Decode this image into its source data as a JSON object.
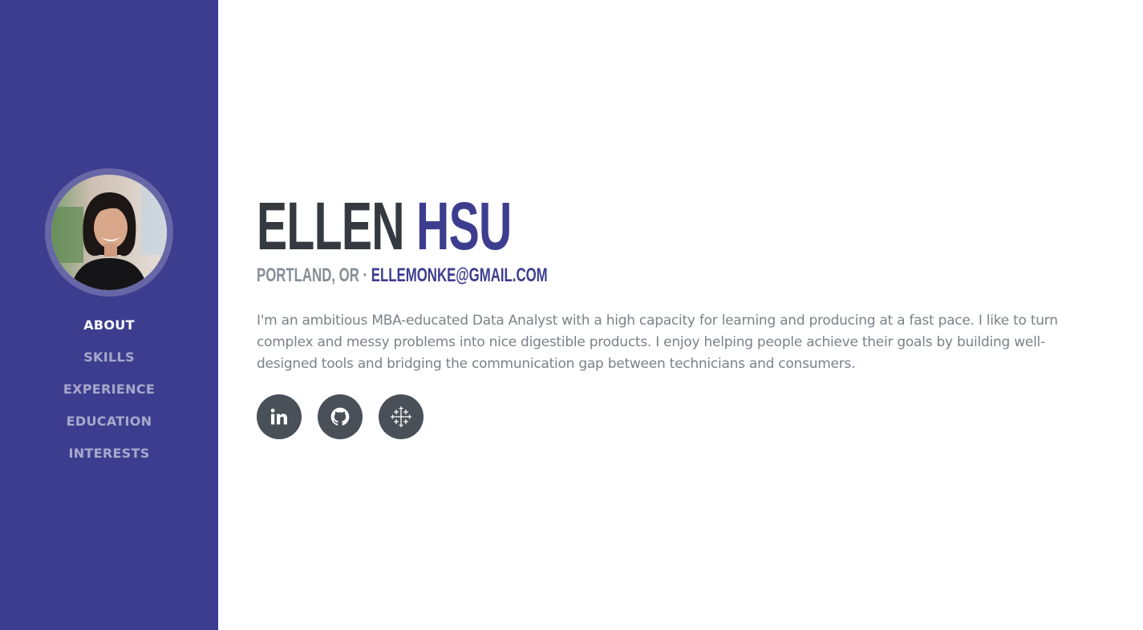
{
  "sidebar": {
    "avatar_alt": "Ellen Hsu profile photo",
    "nav": [
      {
        "label": "ABOUT",
        "active": true
      },
      {
        "label": "SKILLS",
        "active": false
      },
      {
        "label": "EXPERIENCE",
        "active": false
      },
      {
        "label": "EDUCATION",
        "active": false
      },
      {
        "label": "INTERESTS",
        "active": false
      }
    ]
  },
  "about": {
    "first_name": "ELLEN",
    "last_name": "HSU",
    "location": "PORTLAND, OR",
    "separator": "·",
    "email": "ELLEMONKE@GMAIL.COM",
    "bio": "I'm an ambitious MBA-educated Data Analyst with a high capacity for learning and producing at a fast pace. I like to turn complex and messy problems into nice digestible products. I enjoy helping people achieve their goals by building well-designed tools and bridging the communication gap between technicians and consumers.",
    "social": [
      {
        "icon": "linkedin-icon"
      },
      {
        "icon": "github-icon"
      },
      {
        "icon": "tableau-icon"
      }
    ]
  },
  "colors": {
    "sidebar_bg": "#3d3d8f",
    "accent": "#3d3d8f",
    "heading": "#343a40",
    "muted": "#868e96",
    "social_bg": "#495057"
  }
}
